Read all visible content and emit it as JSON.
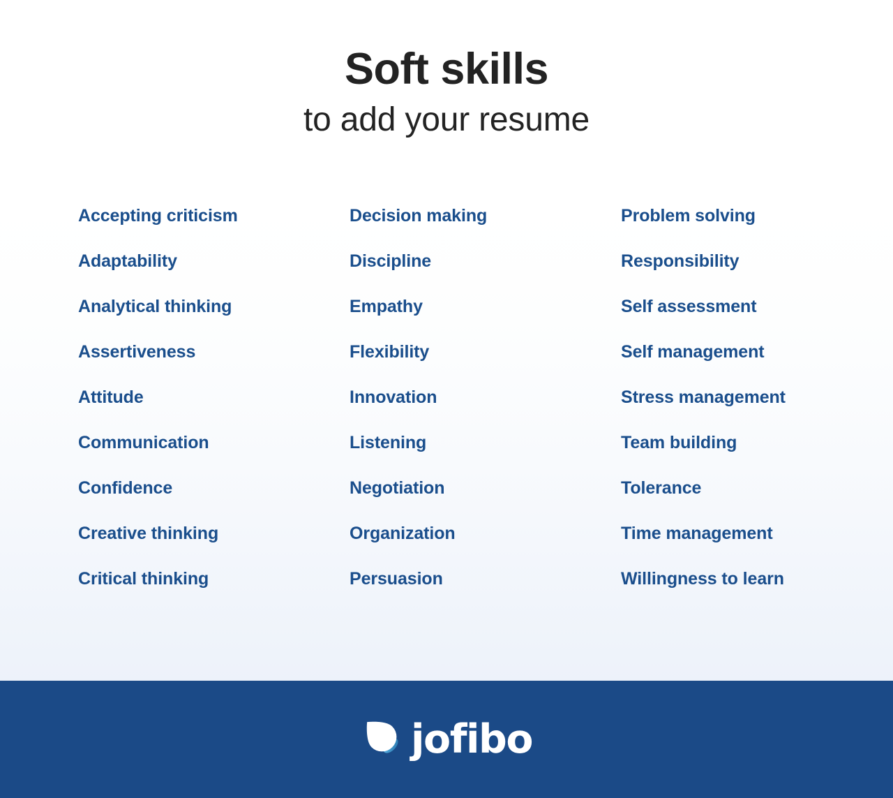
{
  "header": {
    "title": "Soft skills",
    "subtitle": "to add your resume"
  },
  "colors": {
    "skill_text": "#1a4e8c",
    "title_text": "#232323",
    "footer_bg": "#1b4a87",
    "logo_text": "#ffffff",
    "logo_mark_accent": "#4ea3d6",
    "background_top": "#ffffff",
    "background_bottom": "#e8eef8"
  },
  "skills": {
    "columns": [
      {
        "items": [
          "Accepting criticism",
          "Adaptability",
          "Analytical thinking",
          "Assertiveness",
          "Attitude",
          "Communication",
          "Confidence",
          "Creative thinking",
          "Critical thinking"
        ]
      },
      {
        "items": [
          "Decision making",
          "Discipline",
          "Empathy",
          "Flexibility",
          "Innovation",
          "Listening",
          "Negotiation",
          "Organization",
          "Persuasion"
        ]
      },
      {
        "items": [
          "Problem solving",
          "Responsibility",
          "Self assessment",
          "Self management",
          "Stress management",
          "Team building",
          "Tolerance",
          "Time management",
          "Willingness to learn"
        ]
      }
    ]
  },
  "footer": {
    "brand": "jofibo",
    "logo_icon": "jofibo-droplet-icon"
  }
}
